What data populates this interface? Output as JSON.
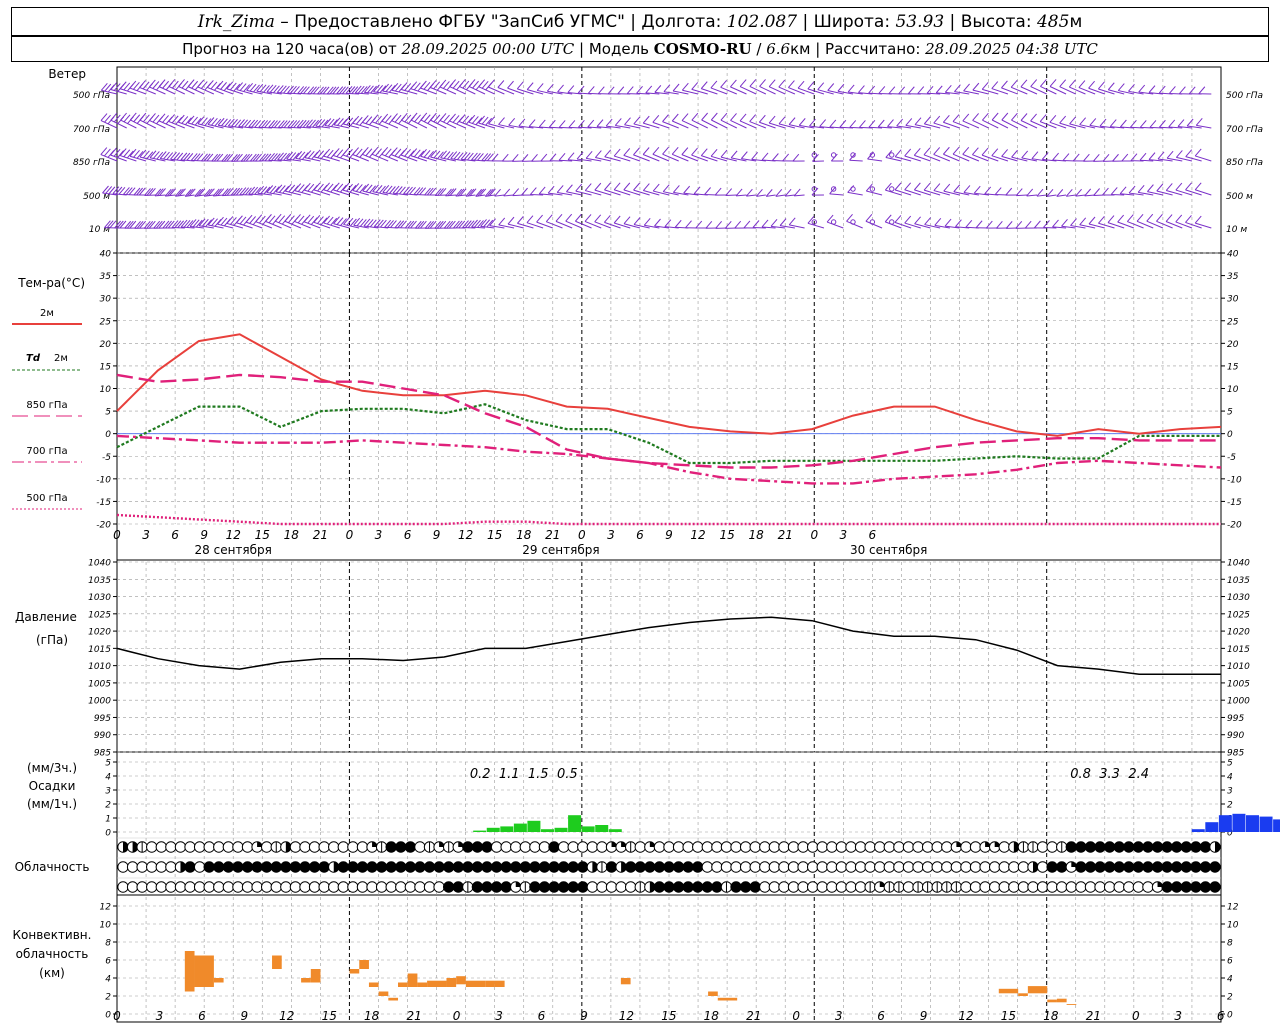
{
  "header": {
    "station": "Irk_Zima",
    "provider": " – Предоставлено ФГБУ \"ЗапСиб УГМС\" | Долгота: ",
    "lon": "102.087",
    "lat_label": " | Широта: ",
    "lat": "53.93",
    "alt_label": " | Высота: ",
    "alt": "485",
    "alt_unit": "м",
    "forecast_label": "Прогноз на 120 часа(ов) от ",
    "forecast_time": "28.09.2025 00:00 UTC",
    "model_label": " | Модель ",
    "model": "COSMO-RU",
    "model_sep": " / ",
    "resolution": "6.6",
    "res_unit": "км",
    "calc_label": " | Рассчитано: ",
    "calc_time": "28.09.2025 04:38 UTC"
  },
  "labels": {
    "wind": "Ветер",
    "temp": "Тем-ра(°С)",
    "t2m": "2м",
    "td2m_a": "Td",
    "td2m_b": "2м",
    "t850": "850 гПа",
    "t700": "700 гПа",
    "t500": "500 гПа",
    "pressure": "Давление",
    "pressure_unit": "(гПа)",
    "precip_1": "(мм/3ч.)",
    "precip_2": "Осадки",
    "precip_3": "(мм/1ч.)",
    "cloud": "Облачность",
    "conv_1": "Конвективн.",
    "conv_2": "облачность",
    "conv_3": "(км)"
  },
  "colors": {
    "t2m": "#e8403c",
    "td2m": "#1f7a1f",
    "t850": "#e0207a",
    "precip_green": "#1ecc1e",
    "precip_blue": "#1a3cf0",
    "wind": "#7a30c8",
    "conv": "#f08a2a"
  },
  "chart_data": [
    {
      "type": "barbs",
      "name": "wind",
      "levels": [
        "500 гПа",
        "700 гПа",
        "850 гПа",
        "500 м",
        "10 м"
      ]
    },
    {
      "type": "line",
      "name": "temperature",
      "x_hours": [
        0,
        3,
        6,
        9,
        12,
        15,
        18,
        21,
        24,
        27,
        30,
        33,
        36,
        39,
        42,
        45,
        48,
        51,
        54,
        57,
        60,
        63,
        66,
        69,
        72,
        75,
        78,
        81,
        84,
        87,
        90,
        93,
        96,
        99,
        102
      ],
      "ylim": [
        -20,
        40
      ],
      "yticks": [
        -20,
        -15,
        -10,
        -5,
        0,
        5,
        10,
        15,
        20,
        25,
        30,
        35,
        40
      ],
      "xtick_labels": [
        "0",
        "3",
        "6",
        "9",
        "12",
        "15",
        "18",
        "21",
        "0",
        "3",
        "6",
        "9",
        "12",
        "15",
        "18",
        "21",
        "0",
        "3",
        "6",
        "9",
        "12",
        "15",
        "18",
        "21",
        "0",
        "3",
        "6"
      ],
      "day_labels": [
        "28 сентября",
        "29 сентября",
        "30 сентября"
      ],
      "series": [
        {
          "key": "t2m",
          "values": [
            5,
            14,
            20.5,
            22,
            17,
            12,
            9.5,
            8.5,
            8.5,
            9.5,
            8.5,
            6,
            5.5,
            3.5,
            1.5,
            0.5,
            0,
            1,
            4,
            6,
            6,
            3,
            0.5,
            -0.5,
            1,
            0,
            1,
            1.5
          ]
        },
        {
          "key": "td2m",
          "values": [
            -3,
            1.5,
            6,
            6,
            1.5,
            5,
            5.5,
            5.5,
            4.5,
            6.5,
            3,
            1,
            1,
            -2,
            -6.5,
            -6.5,
            -6,
            -6,
            -6,
            -6,
            -6,
            -5.5,
            -5,
            -5.5,
            -5.5,
            -0.5,
            -0.5,
            -0.5
          ]
        },
        {
          "key": "t850",
          "values": [
            13,
            11.5,
            12,
            13,
            12.5,
            11.5,
            11.5,
            10,
            8.5,
            4.5,
            1.5,
            -3.5,
            -5.5,
            -6.5,
            -7,
            -7.5,
            -7.5,
            -7,
            -6,
            -4.5,
            -3,
            -2,
            -1.5,
            -1,
            -1,
            -1.5,
            -1.5,
            -1.5
          ]
        },
        {
          "key": "t700",
          "values": [
            -0.5,
            -1,
            -1.5,
            -2,
            -2,
            -2,
            -1.5,
            -2,
            -2.5,
            -3,
            -4,
            -4.5,
            -5.5,
            -6.5,
            -8.5,
            -10,
            -10.5,
            -11,
            -11,
            -10,
            -9.5,
            -9,
            -8,
            -6.5,
            -6,
            -6.5,
            -7,
            -7.5
          ]
        },
        {
          "key": "t500",
          "values": [
            -18,
            -18.5,
            -19,
            -19.5,
            -20,
            -20,
            -20,
            -20,
            -20,
            -19.5,
            -19.5,
            -20,
            -20,
            -20,
            -20,
            -20,
            -20,
            -20,
            -20,
            -20,
            -20,
            -20,
            -20,
            -20,
            -20,
            -20,
            -20,
            -20
          ]
        }
      ]
    },
    {
      "type": "line",
      "name": "pressure",
      "ylim": [
        985,
        1040
      ],
      "yticks": [
        985,
        990,
        995,
        1000,
        1005,
        1010,
        1015,
        1020,
        1025,
        1030,
        1035,
        1040
      ],
      "values": [
        1015,
        1012,
        1010,
        1009,
        1011,
        1012,
        1012,
        1011.5,
        1012.5,
        1015,
        1015,
        1017,
        1019,
        1021,
        1022.5,
        1023.5,
        1024,
        1023,
        1020,
        1018.5,
        1018.5,
        1017.5,
        1014.5,
        1010,
        1009,
        1007.5,
        1007.5,
        1007.5
      ]
    },
    {
      "type": "bar",
      "name": "precipitation",
      "ylim": [
        0,
        5
      ],
      "yticks": [
        0,
        1,
        2,
        3,
        4,
        5
      ],
      "bars_3h_labels": [
        {
          "hour": 7.5,
          "label": "0.2"
        },
        {
          "hour": 10.5,
          "label": "1.1"
        },
        {
          "hour": 13.5,
          "label": "1.5"
        },
        {
          "hour": 16.5,
          "label": "0.5"
        },
        {
          "hour": 103.5,
          "label": "0.8"
        },
        {
          "hour": 106.5,
          "label": "3.3"
        },
        {
          "hour": 109.5,
          "label": "2.4"
        }
      ],
      "hourly": [
        {
          "hour": 1,
          "value": 0.1,
          "color": "green"
        },
        {
          "hour": 2,
          "value": 0.3,
          "color": "green"
        },
        {
          "hour": 3,
          "value": 0.4,
          "color": "green"
        },
        {
          "hour": 4,
          "value": 0.6,
          "color": "green"
        },
        {
          "hour": 5,
          "value": 0.8,
          "color": "green"
        },
        {
          "hour": 6,
          "value": 0.2,
          "color": "green"
        },
        {
          "hour": 7,
          "value": 0.3,
          "color": "green"
        },
        {
          "hour": 8,
          "value": 1.2,
          "color": "green"
        },
        {
          "hour": 9,
          "value": 0.4,
          "color": "green"
        },
        {
          "hour": 10,
          "value": 0.5,
          "color": "green"
        },
        {
          "hour": 11,
          "value": 0.2,
          "color": "green"
        },
        {
          "hour": 24,
          "value": 0.2,
          "color": "blue"
        },
        {
          "hour": 25,
          "value": 0.7,
          "color": "blue"
        },
        {
          "hour": 26,
          "value": 1.2,
          "color": "blue"
        },
        {
          "hour": 27,
          "value": 1.3,
          "color": "blue"
        },
        {
          "hour": 28,
          "value": 1.2,
          "color": "blue"
        },
        {
          "hour": 29,
          "value": 1.1,
          "color": "blue"
        },
        {
          "hour": 30,
          "value": 0.9,
          "color": "blue"
        },
        {
          "hour": 31,
          "value": 0.5,
          "color": "blue"
        }
      ]
    },
    {
      "type": "symbols",
      "name": "cloudiness",
      "rows": [
        "3310000000000020130000000021444012124440000004000002210200000000000000000000000000000002002203110014444444444444443",
        "0000003404444444444444344444444444444444444444444314344444444000000000000000000000000000000000030442444444444444444444444",
        "0000000000000000000000000000000000441444421444444000001344444441444000000000001211011111000000000000000000002444444444444"
      ]
    },
    {
      "type": "bar",
      "name": "convective_cloud",
      "ylim": [
        0,
        13
      ],
      "yticks": [
        0,
        2,
        4,
        6,
        8,
        10,
        12
      ],
      "bars": [
        {
          "start": 7,
          "end": 8,
          "base": 2.5,
          "top": 7
        },
        {
          "start": 8,
          "end": 10,
          "base": 3,
          "top": 6.5
        },
        {
          "start": 10,
          "end": 11,
          "base": 3.5,
          "top": 4
        },
        {
          "start": 16,
          "end": 17,
          "base": 5,
          "top": 6.5
        },
        {
          "start": 19,
          "end": 20,
          "base": 3.5,
          "top": 4
        },
        {
          "start": 20,
          "end": 21,
          "base": 3.5,
          "top": 5
        },
        {
          "start": 24,
          "end": 25,
          "base": 4.5,
          "top": 5
        },
        {
          "start": 25,
          "end": 26,
          "base": 5,
          "top": 6
        },
        {
          "start": 26,
          "end": 27,
          "base": 3,
          "top": 3.5
        },
        {
          "start": 27,
          "end": 28,
          "base": 2,
          "top": 2.5
        },
        {
          "start": 28,
          "end": 29,
          "base": 1.5,
          "top": 1.8
        },
        {
          "start": 29,
          "end": 30,
          "base": 3,
          "top": 3.5
        },
        {
          "start": 30,
          "end": 31,
          "base": 3,
          "top": 4.5
        },
        {
          "start": 31,
          "end": 32,
          "base": 3,
          "top": 3.5
        },
        {
          "start": 32,
          "end": 34,
          "base": 3,
          "top": 3.7
        },
        {
          "start": 34,
          "end": 35,
          "base": 3,
          "top": 4
        },
        {
          "start": 35,
          "end": 36,
          "base": 3.3,
          "top": 4.2
        },
        {
          "start": 36,
          "end": 38,
          "base": 3,
          "top": 3.7
        },
        {
          "start": 38,
          "end": 39,
          "base": 3,
          "top": 3.7
        },
        {
          "start": 39,
          "end": 40,
          "base": 3,
          "top": 3.7
        },
        {
          "start": 52,
          "end": 53,
          "base": 3.3,
          "top": 4
        },
        {
          "start": 61,
          "end": 62,
          "base": 2,
          "top": 2.5
        },
        {
          "start": 62,
          "end": 64,
          "base": 1.5,
          "top": 1.8
        },
        {
          "start": 91,
          "end": 93,
          "base": 2.3,
          "top": 2.8
        },
        {
          "start": 93,
          "end": 94,
          "base": 2,
          "top": 2.3
        },
        {
          "start": 94,
          "end": 96,
          "base": 2.3,
          "top": 3.1
        },
        {
          "start": 96,
          "end": 97,
          "base": 1.3,
          "top": 1.6
        },
        {
          "start": 97,
          "end": 98,
          "base": 1.3,
          "top": 1.7
        },
        {
          "start": 98,
          "end": 99,
          "base": 1,
          "top": 1.1
        }
      ]
    }
  ]
}
